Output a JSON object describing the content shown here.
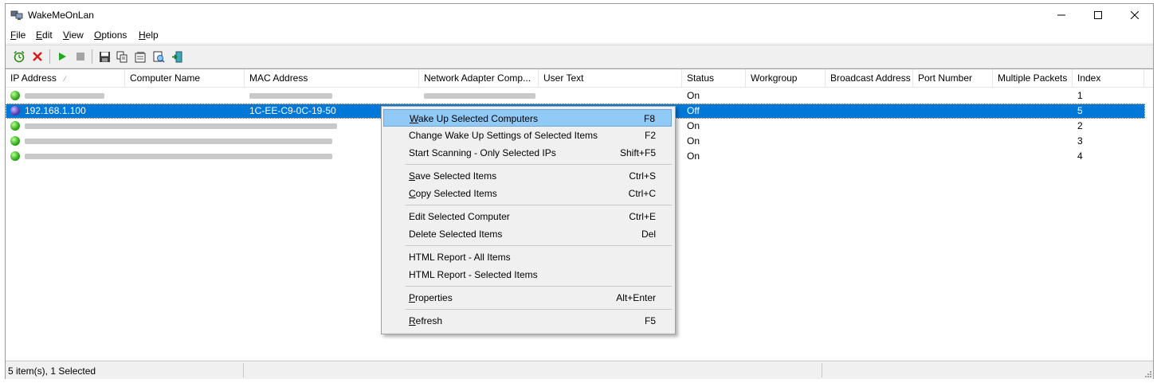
{
  "window": {
    "title": "WakeMeOnLan",
    "title_icon": "network-computer-icon"
  },
  "menu": [
    {
      "label": "File",
      "accel": "F",
      "rest": "ile"
    },
    {
      "label": "Edit",
      "accel": "E",
      "rest": "dit"
    },
    {
      "label": "View",
      "accel": "V",
      "rest": "iew"
    },
    {
      "label": "Options",
      "accel": "O",
      "rest": "ptions"
    },
    {
      "label": "Help",
      "accel": "H",
      "rest": "elp"
    }
  ],
  "toolbar": {
    "icons": [
      "wake-alarm-icon",
      "delete-icon",
      "play-icon",
      "stop-icon",
      "save-icon",
      "copy-icon",
      "properties-icon",
      "html-report-icon",
      "exit-icon"
    ]
  },
  "columns": [
    "IP Address",
    "Computer Name",
    "MAC Address",
    "Network Adapter Comp...",
    "User Text",
    "Status",
    "Workgroup",
    "Broadcast Address",
    "Port Number",
    "Multiple Packets",
    "Index"
  ],
  "rows": [
    {
      "ip": "",
      "mac": "",
      "status": "On",
      "index": "1",
      "state": "on",
      "selected": false
    },
    {
      "ip": "192.168.1.100",
      "mac": "1C-EE-C9-0C-19-50",
      "status": "Off",
      "index": "5",
      "state": "off",
      "selected": true
    },
    {
      "ip": "",
      "mac": "",
      "status": "On",
      "index": "2",
      "state": "on",
      "selected": false
    },
    {
      "ip": "",
      "mac": "",
      "status": "On",
      "index": "3",
      "state": "on",
      "selected": false
    },
    {
      "ip": "",
      "mac": "",
      "status": "On",
      "index": "4",
      "state": "on",
      "selected": false
    }
  ],
  "status_bar": {
    "text": "5 item(s), 1 Selected"
  },
  "context_menu": {
    "items": [
      {
        "accel": "W",
        "rest": "ake Up Selected Computers",
        "shortcut": "F8",
        "highlighted": true
      },
      {
        "accel": "",
        "rest": "Change Wake Up Settings of Selected Items",
        "shortcut": "F2"
      },
      {
        "accel": "",
        "rest": "Start Scanning - Only Selected IPs",
        "shortcut": "Shift+F5"
      },
      {
        "accel": "S",
        "rest": "ave Selected Items",
        "shortcut": "Ctrl+S"
      },
      {
        "accel": "C",
        "rest": "opy Selected Items",
        "shortcut": "Ctrl+C"
      },
      {
        "accel": "",
        "rest": "Edit Selected Computer",
        "shortcut": "Ctrl+E"
      },
      {
        "accel": "",
        "rest": "Delete Selected Items",
        "shortcut": "Del"
      },
      {
        "accel": "",
        "rest": "HTML Report - All Items",
        "shortcut": ""
      },
      {
        "accel": "",
        "rest": "HTML Report - Selected Items",
        "shortcut": ""
      },
      {
        "accel": "P",
        "rest": "roperties",
        "shortcut": "Alt+Enter"
      },
      {
        "accel": "R",
        "rest": "efresh",
        "shortcut": "F5"
      }
    ]
  }
}
